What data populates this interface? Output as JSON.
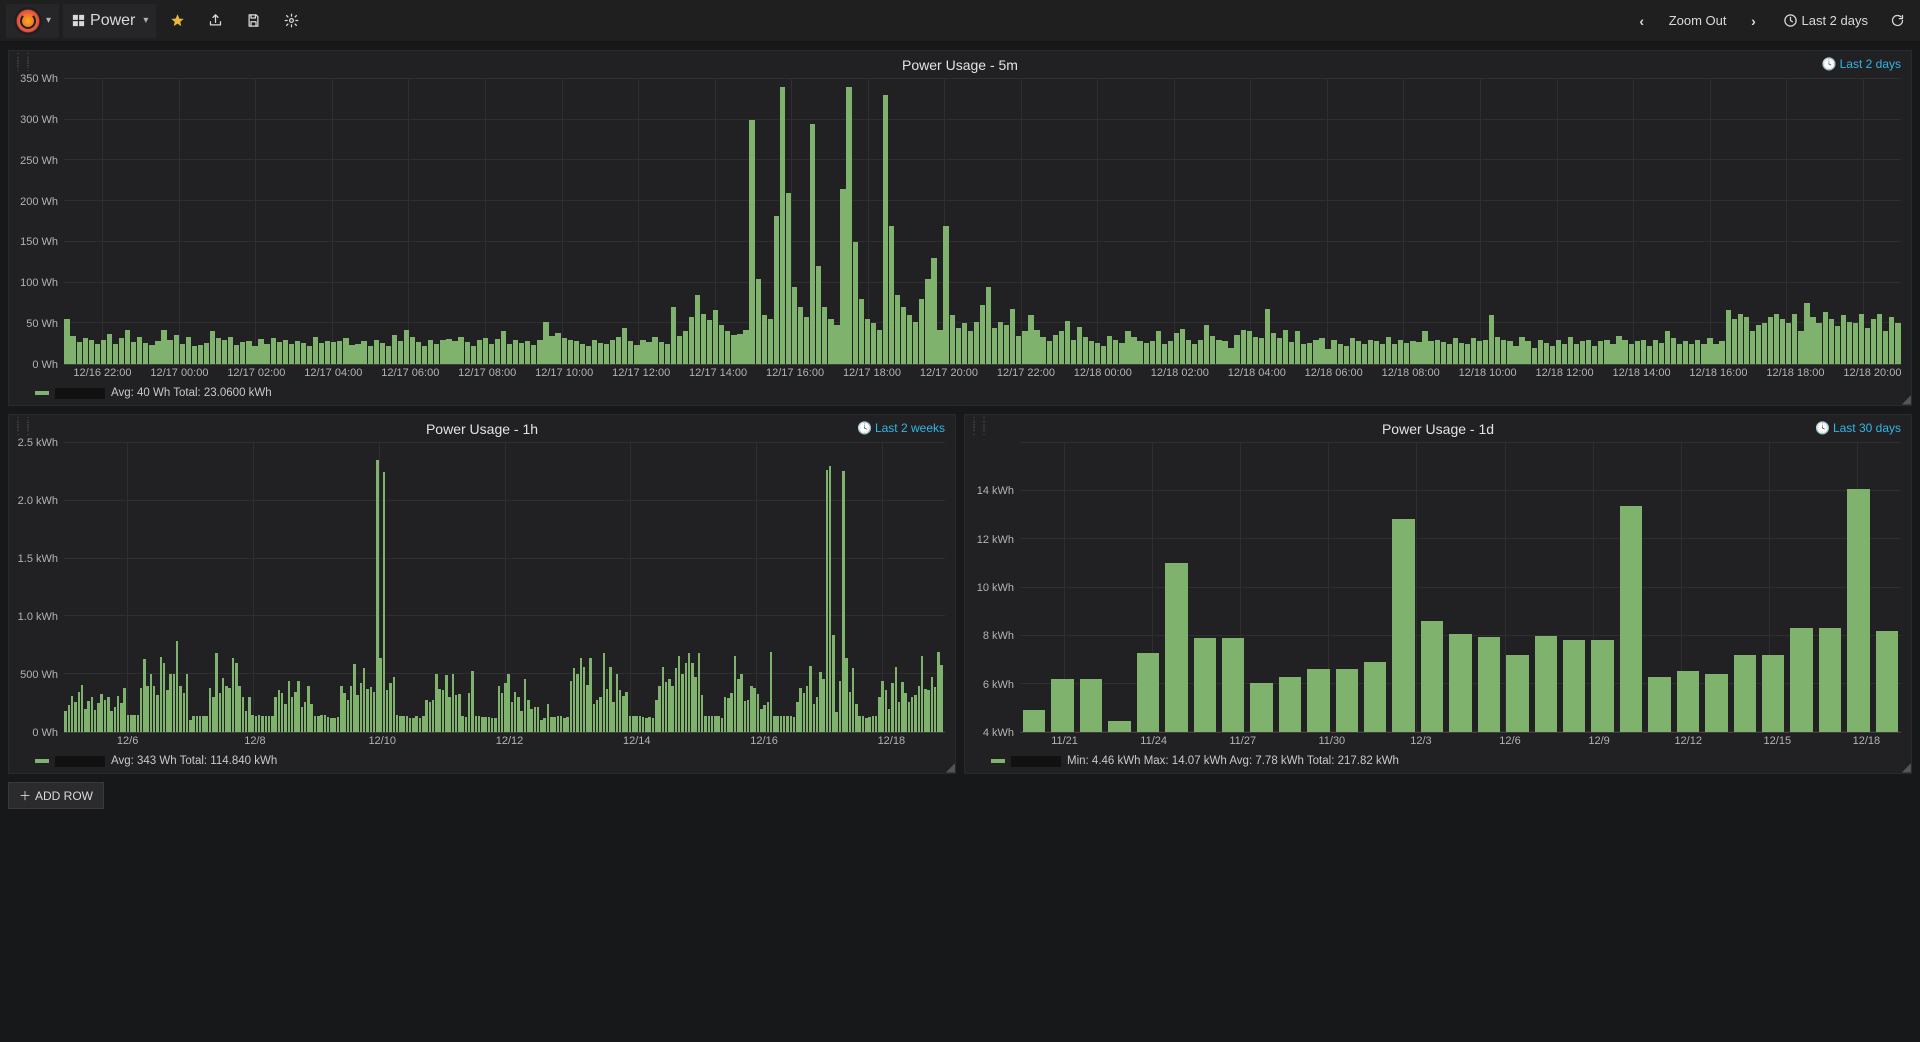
{
  "navbar": {
    "dashboard_title": "Power",
    "zoom_out": "Zoom Out",
    "time_range": "Last 2 days"
  },
  "panels": {
    "p5m": {
      "title": "Power Usage - 5m",
      "range_label": "Last 2 days",
      "legend": "Avg: 40 Wh  Total: 23.0600 kWh"
    },
    "p1h": {
      "title": "Power Usage - 1h",
      "range_label": "Last 2 weeks",
      "legend": "Avg: 343 Wh  Total: 114.840 kWh"
    },
    "p1d": {
      "title": "Power Usage - 1d",
      "range_label": "Last 30 days",
      "legend": "Min: 4.46 kWh  Max: 14.07 kWh  Avg: 7.78 kWh  Total: 217.82 kWh"
    }
  },
  "add_row": "ADD ROW",
  "colors": {
    "bar": "#7eb26d",
    "link": "#33b5e5"
  },
  "chart_data": [
    {
      "id": "p5m",
      "type": "bar",
      "title": "Power Usage - 5m",
      "ylabel": "Wh",
      "ylim": [
        0,
        350
      ],
      "yticks": [
        0,
        50,
        100,
        150,
        200,
        250,
        300,
        350
      ],
      "ytick_labels": [
        "0 Wh",
        "50 Wh",
        "100 Wh",
        "150 Wh",
        "200 Wh",
        "250 Wh",
        "300 Wh",
        "350 Wh"
      ],
      "x_start": "12/16 22:00",
      "x_end": "12/18 21:00",
      "xtick_labels": [
        "12/16 22:00",
        "12/17 00:00",
        "12/17 02:00",
        "12/17 04:00",
        "12/17 06:00",
        "12/17 08:00",
        "12/17 10:00",
        "12/17 12:00",
        "12/17 14:00",
        "12/17 16:00",
        "12/17 18:00",
        "12/17 20:00",
        "12/17 22:00",
        "12/18 00:00",
        "12/18 02:00",
        "12/18 04:00",
        "12/18 06:00",
        "12/18 08:00",
        "12/18 10:00",
        "12/18 12:00",
        "12/18 14:00",
        "12/18 16:00",
        "12/18 18:00",
        "12/18 20:00"
      ],
      "values": [
        55,
        34,
        27,
        32,
        30,
        25,
        30,
        37,
        25,
        32,
        42,
        27,
        33,
        26,
        23,
        28,
        42,
        30,
        36,
        25,
        33,
        22,
        23,
        26,
        40,
        32,
        30,
        33,
        23,
        27,
        28,
        22,
        31,
        25,
        32,
        27,
        29,
        25,
        28,
        26,
        22,
        33,
        26,
        28,
        27,
        28,
        32,
        23,
        25,
        28,
        22,
        30,
        26,
        22,
        36,
        28,
        42,
        33,
        27,
        22,
        30,
        25,
        30,
        31,
        28,
        33,
        27,
        22,
        29,
        32,
        25,
        31,
        40,
        25,
        30,
        26,
        28,
        23,
        30,
        52,
        35,
        38,
        32,
        30,
        28,
        25,
        22,
        30,
        26,
        25,
        30,
        33,
        44,
        28,
        23,
        30,
        27,
        33,
        27,
        25,
        70,
        35,
        41,
        58,
        85,
        62,
        54,
        66,
        48,
        40,
        36,
        37,
        42,
        300,
        105,
        60,
        55,
        182,
        340,
        210,
        95,
        70,
        58,
        295,
        120,
        70,
        55,
        48,
        215,
        340,
        150,
        80,
        55,
        50,
        42,
        330,
        170,
        85,
        70,
        60,
        52,
        80,
        105,
        130,
        42,
        170,
        60,
        44,
        50,
        40,
        52,
        73,
        95,
        44,
        52,
        48,
        68,
        34,
        40,
        60,
        42,
        33,
        28,
        36,
        40,
        53,
        30,
        46,
        33,
        28,
        26,
        22,
        35,
        30,
        26,
        40,
        33,
        28,
        26,
        28,
        40,
        25,
        28,
        38,
        43,
        30,
        25,
        30,
        48,
        35,
        30,
        28,
        20,
        36,
        42,
        40,
        33,
        32,
        67,
        38,
        32,
        42,
        27,
        40,
        25,
        26,
        30,
        32,
        18,
        30,
        25,
        22,
        32,
        28,
        24,
        30,
        28,
        24,
        33,
        25,
        30,
        26,
        28,
        27,
        40,
        28,
        30,
        27,
        25,
        32,
        26,
        25,
        32,
        28,
        30,
        60,
        33,
        30,
        28,
        22,
        33,
        28,
        20,
        30,
        26,
        22,
        30,
        25,
        33,
        25,
        28,
        30,
        22,
        28,
        30,
        25,
        35,
        29,
        25,
        28,
        30,
        22,
        30,
        26,
        40,
        32,
        25,
        28,
        25,
        30,
        24,
        32,
        25,
        28,
        66,
        55,
        62,
        58,
        40,
        48,
        50,
        58,
        62,
        55,
        50,
        62,
        40,
        75,
        58,
        50,
        64,
        55,
        47,
        60,
        52,
        50,
        62,
        44,
        55,
        62,
        40,
        58,
        50
      ],
      "series_name": "",
      "stats": {
        "avg": "40 Wh",
        "total": "23.0600 kWh"
      }
    },
    {
      "id": "p1h",
      "type": "bar",
      "title": "Power Usage - 1h",
      "ylabel": "Wh / kWh",
      "ylim": [
        0,
        2500
      ],
      "yticks": [
        0,
        500,
        1000,
        1500,
        2000,
        2500
      ],
      "ytick_labels": [
        "0 Wh",
        "500 Wh",
        "1.0 kWh",
        "1.5 kWh",
        "2.0 kWh",
        "2.5 kWh"
      ],
      "x_start": "12/05",
      "x_end": "12/18",
      "xtick_labels": [
        "12/6",
        "12/8",
        "12/10",
        "12/12",
        "12/14",
        "12/16",
        "12/18"
      ],
      "values": [
        180,
        230,
        310,
        260,
        350,
        410,
        200,
        270,
        300,
        190,
        250,
        330,
        280,
        300,
        180,
        220,
        310,
        250,
        380,
        150,
        150,
        150,
        150,
        380,
        630,
        400,
        500,
        400,
        320,
        650,
        600,
        360,
        500,
        500,
        790,
        400,
        340,
        500,
        100,
        140,
        140,
        140,
        140,
        140,
        380,
        300,
        680,
        340,
        470,
        400,
        380,
        640,
        600,
        400,
        300,
        180,
        300,
        150,
        140,
        150,
        140,
        140,
        140,
        140,
        300,
        360,
        340,
        240,
        440,
        300,
        350,
        440,
        220,
        260,
        400,
        240,
        140,
        140,
        150,
        150,
        130,
        120,
        120,
        130,
        400,
        340,
        280,
        400,
        590,
        320,
        420,
        550,
        370,
        390,
        350,
        2350,
        640,
        2250,
        360,
        420,
        480,
        150,
        140,
        140,
        140,
        120,
        120,
        140,
        120,
        140,
        280,
        260,
        280,
        500,
        370,
        360,
        490,
        300,
        500,
        320,
        330,
        140,
        130,
        340,
        530,
        140,
        140,
        130,
        130,
        130,
        120,
        120,
        400,
        340,
        420,
        500,
        260,
        350,
        300,
        180,
        460,
        280,
        200,
        220,
        220,
        100,
        120,
        240,
        130,
        130,
        140,
        140,
        120,
        130,
        440,
        550,
        500,
        640,
        560,
        410,
        640,
        240,
        280,
        300,
        680,
        370,
        560,
        260,
        500,
        360,
        310,
        350,
        140,
        140,
        140,
        140,
        130,
        120,
        130,
        120,
        280,
        400,
        560,
        430,
        460,
        400,
        550,
        660,
        500,
        600,
        680,
        600,
        480,
        680,
        320,
        140,
        140,
        140,
        140,
        140,
        120,
        300,
        290,
        340,
        660,
        460,
        500,
        270,
        280,
        400,
        380,
        330,
        200,
        230,
        260,
        690,
        140,
        140,
        140,
        140,
        140,
        140,
        130,
        260,
        380,
        340,
        400,
        570,
        240,
        300,
        520,
        460,
        2270,
        2300,
        840,
        170,
        440,
        2260,
        640,
        350,
        550,
        240,
        140,
        140,
        120,
        130,
        140,
        140,
        300,
        440,
        360,
        200,
        420,
        560,
        260,
        430,
        340,
        260,
        300,
        320,
        400,
        660,
        370,
        360,
        480,
        390,
        690,
        580
      ],
      "series_name": "",
      "stats": {
        "avg": "343 Wh",
        "total": "114.840 kWh"
      }
    },
    {
      "id": "p1d",
      "type": "bar",
      "title": "Power Usage - 1d",
      "ylabel": "kWh",
      "ylim": [
        4,
        16
      ],
      "yticks": [
        4,
        6,
        8,
        10,
        12,
        14,
        16
      ],
      "ytick_labels": [
        "4 kWh",
        "6 kWh",
        "8 kWh",
        "10 kWh",
        "12 kWh",
        "14 kWh"
      ],
      "categories": [
        "11/21",
        "11/22",
        "11/23",
        "11/24",
        "11/25",
        "11/26",
        "11/27",
        "11/28",
        "11/29",
        "11/30",
        "12/1",
        "12/2",
        "12/3",
        "12/4",
        "12/5",
        "12/6",
        "12/7",
        "12/8",
        "12/9",
        "12/10",
        "12/11",
        "12/12",
        "12/13",
        "12/14",
        "12/15",
        "12/16",
        "12/17",
        "12/18"
      ],
      "xtick_labels": [
        "11/21",
        "11/24",
        "11/27",
        "11/30",
        "12/3",
        "12/6",
        "12/9",
        "12/12",
        "12/15",
        "12/18"
      ],
      "values": [
        4.9,
        6.2,
        6.2,
        4.46,
        7.3,
        11.0,
        7.9,
        7.9,
        6.05,
        6.3,
        6.6,
        6.6,
        6.9,
        12.85,
        8.6,
        8.05,
        7.95,
        7.2,
        8.0,
        7.8,
        7.8,
        13.4,
        6.3,
        6.55,
        6.4,
        7.2,
        7.2,
        8.3,
        8.3,
        14.07,
        8.2
      ],
      "series_name": "",
      "stats": {
        "min": "4.46 kWh",
        "max": "14.07 kWh",
        "avg": "7.78 kWh",
        "total": "217.82 kWh"
      }
    }
  ]
}
